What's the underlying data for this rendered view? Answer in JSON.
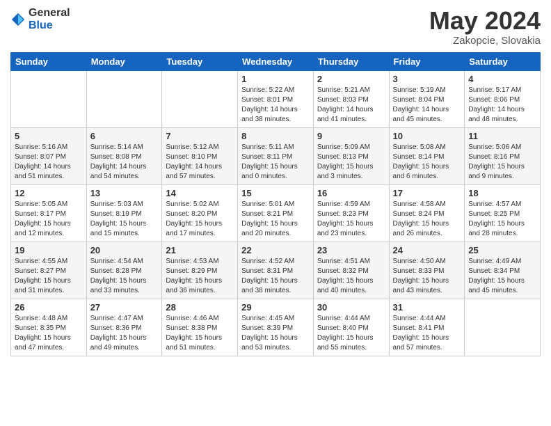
{
  "logo": {
    "general": "General",
    "blue": "Blue"
  },
  "title": "May 2024",
  "subtitle": "Zakopcie, Slovakia",
  "days_of_week": [
    "Sunday",
    "Monday",
    "Tuesday",
    "Wednesday",
    "Thursday",
    "Friday",
    "Saturday"
  ],
  "weeks": [
    [
      {
        "day": "",
        "info": ""
      },
      {
        "day": "",
        "info": ""
      },
      {
        "day": "",
        "info": ""
      },
      {
        "day": "1",
        "info": "Sunrise: 5:22 AM\nSunset: 8:01 PM\nDaylight: 14 hours\nand 38 minutes."
      },
      {
        "day": "2",
        "info": "Sunrise: 5:21 AM\nSunset: 8:03 PM\nDaylight: 14 hours\nand 41 minutes."
      },
      {
        "day": "3",
        "info": "Sunrise: 5:19 AM\nSunset: 8:04 PM\nDaylight: 14 hours\nand 45 minutes."
      },
      {
        "day": "4",
        "info": "Sunrise: 5:17 AM\nSunset: 8:06 PM\nDaylight: 14 hours\nand 48 minutes."
      }
    ],
    [
      {
        "day": "5",
        "info": "Sunrise: 5:16 AM\nSunset: 8:07 PM\nDaylight: 14 hours\nand 51 minutes."
      },
      {
        "day": "6",
        "info": "Sunrise: 5:14 AM\nSunset: 8:08 PM\nDaylight: 14 hours\nand 54 minutes."
      },
      {
        "day": "7",
        "info": "Sunrise: 5:12 AM\nSunset: 8:10 PM\nDaylight: 14 hours\nand 57 minutes."
      },
      {
        "day": "8",
        "info": "Sunrise: 5:11 AM\nSunset: 8:11 PM\nDaylight: 15 hours\nand 0 minutes."
      },
      {
        "day": "9",
        "info": "Sunrise: 5:09 AM\nSunset: 8:13 PM\nDaylight: 15 hours\nand 3 minutes."
      },
      {
        "day": "10",
        "info": "Sunrise: 5:08 AM\nSunset: 8:14 PM\nDaylight: 15 hours\nand 6 minutes."
      },
      {
        "day": "11",
        "info": "Sunrise: 5:06 AM\nSunset: 8:16 PM\nDaylight: 15 hours\nand 9 minutes."
      }
    ],
    [
      {
        "day": "12",
        "info": "Sunrise: 5:05 AM\nSunset: 8:17 PM\nDaylight: 15 hours\nand 12 minutes."
      },
      {
        "day": "13",
        "info": "Sunrise: 5:03 AM\nSunset: 8:19 PM\nDaylight: 15 hours\nand 15 minutes."
      },
      {
        "day": "14",
        "info": "Sunrise: 5:02 AM\nSunset: 8:20 PM\nDaylight: 15 hours\nand 17 minutes."
      },
      {
        "day": "15",
        "info": "Sunrise: 5:01 AM\nSunset: 8:21 PM\nDaylight: 15 hours\nand 20 minutes."
      },
      {
        "day": "16",
        "info": "Sunrise: 4:59 AM\nSunset: 8:23 PM\nDaylight: 15 hours\nand 23 minutes."
      },
      {
        "day": "17",
        "info": "Sunrise: 4:58 AM\nSunset: 8:24 PM\nDaylight: 15 hours\nand 26 minutes."
      },
      {
        "day": "18",
        "info": "Sunrise: 4:57 AM\nSunset: 8:25 PM\nDaylight: 15 hours\nand 28 minutes."
      }
    ],
    [
      {
        "day": "19",
        "info": "Sunrise: 4:55 AM\nSunset: 8:27 PM\nDaylight: 15 hours\nand 31 minutes."
      },
      {
        "day": "20",
        "info": "Sunrise: 4:54 AM\nSunset: 8:28 PM\nDaylight: 15 hours\nand 33 minutes."
      },
      {
        "day": "21",
        "info": "Sunrise: 4:53 AM\nSunset: 8:29 PM\nDaylight: 15 hours\nand 36 minutes."
      },
      {
        "day": "22",
        "info": "Sunrise: 4:52 AM\nSunset: 8:31 PM\nDaylight: 15 hours\nand 38 minutes."
      },
      {
        "day": "23",
        "info": "Sunrise: 4:51 AM\nSunset: 8:32 PM\nDaylight: 15 hours\nand 40 minutes."
      },
      {
        "day": "24",
        "info": "Sunrise: 4:50 AM\nSunset: 8:33 PM\nDaylight: 15 hours\nand 43 minutes."
      },
      {
        "day": "25",
        "info": "Sunrise: 4:49 AM\nSunset: 8:34 PM\nDaylight: 15 hours\nand 45 minutes."
      }
    ],
    [
      {
        "day": "26",
        "info": "Sunrise: 4:48 AM\nSunset: 8:35 PM\nDaylight: 15 hours\nand 47 minutes."
      },
      {
        "day": "27",
        "info": "Sunrise: 4:47 AM\nSunset: 8:36 PM\nDaylight: 15 hours\nand 49 minutes."
      },
      {
        "day": "28",
        "info": "Sunrise: 4:46 AM\nSunset: 8:38 PM\nDaylight: 15 hours\nand 51 minutes."
      },
      {
        "day": "29",
        "info": "Sunrise: 4:45 AM\nSunset: 8:39 PM\nDaylight: 15 hours\nand 53 minutes."
      },
      {
        "day": "30",
        "info": "Sunrise: 4:44 AM\nSunset: 8:40 PM\nDaylight: 15 hours\nand 55 minutes."
      },
      {
        "day": "31",
        "info": "Sunrise: 4:44 AM\nSunset: 8:41 PM\nDaylight: 15 hours\nand 57 minutes."
      },
      {
        "day": "",
        "info": ""
      }
    ]
  ]
}
